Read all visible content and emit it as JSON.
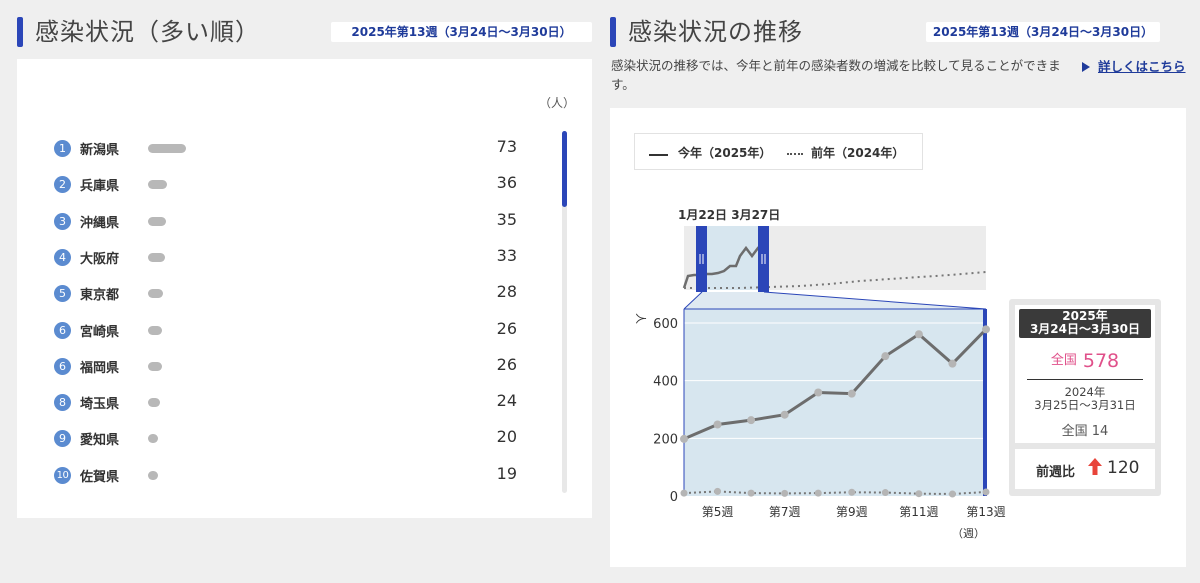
{
  "left": {
    "title": "感染状況（多い順）",
    "week_badge": "2025年第13週（3月24日〜3月30日）",
    "unit": "（人）",
    "ranking": [
      {
        "rank": "1",
        "pref": "新潟県",
        "value": 73
      },
      {
        "rank": "2",
        "pref": "兵庫県",
        "value": 36
      },
      {
        "rank": "3",
        "pref": "沖縄県",
        "value": 35
      },
      {
        "rank": "4",
        "pref": "大阪府",
        "value": 33
      },
      {
        "rank": "5",
        "pref": "東京都",
        "value": 28
      },
      {
        "rank": "6",
        "pref": "宮崎県",
        "value": 26
      },
      {
        "rank": "6",
        "pref": "福岡県",
        "value": 26
      },
      {
        "rank": "8",
        "pref": "埼玉県",
        "value": 24
      },
      {
        "rank": "9",
        "pref": "愛知県",
        "value": 20
      },
      {
        "rank": "10",
        "pref": "佐賀県",
        "value": 19
      }
    ]
  },
  "right": {
    "title": "感染状況の推移",
    "week_badge": "2025年第13週（3月24日〜3月30日）",
    "description": "感染状況の推移では、今年と前年の感染者数の増減を比較して見ることができます。",
    "detail_link": "詳しくはこちら",
    "legend_current": "今年（2025年）",
    "legend_previous": "前年（2024年）",
    "brush_label": "1月22日 3月27日",
    "y_unit": "人",
    "x_unit": "（週）",
    "info": {
      "date_line1": "2025年",
      "date_line2": "3月24日〜3月30日",
      "label_national": "全国",
      "current_value": "578",
      "prev_line1": "2024年",
      "prev_line2": "3月25日〜3月31日",
      "prev_value": "全国 14",
      "compare_label": "前週比",
      "compare_value": "120"
    }
  },
  "colors": {
    "accent": "#2b46b8",
    "current_line": "#6d6d6d",
    "point": "#b5b5b5",
    "highlight": "#e0508a",
    "up_arrow": "#e8443a",
    "zoom_area": "#d7e6ef"
  },
  "chart_data": {
    "type": "line",
    "xlabel": "週",
    "ylabel": "人",
    "x": [
      4,
      5,
      6,
      7,
      8,
      9,
      10,
      11,
      12,
      13
    ],
    "x_ticks": [
      "第5週",
      "第7週",
      "第9週",
      "第11週",
      "第13週"
    ],
    "ylim": [
      0,
      600
    ],
    "y_ticks": [
      0,
      200,
      400,
      600
    ],
    "series": [
      {
        "name": "今年（2025年）",
        "style": "solid",
        "values": [
          198,
          248,
          263,
          282,
          359,
          355,
          485,
          561,
          459,
          578
        ]
      },
      {
        "name": "前年（2024年）",
        "style": "dotted",
        "values": [
          10,
          16,
          10,
          9,
          10,
          13,
          12,
          8,
          7,
          14
        ]
      }
    ],
    "brush_range": [
      "1月22日",
      "3月27日"
    ]
  }
}
